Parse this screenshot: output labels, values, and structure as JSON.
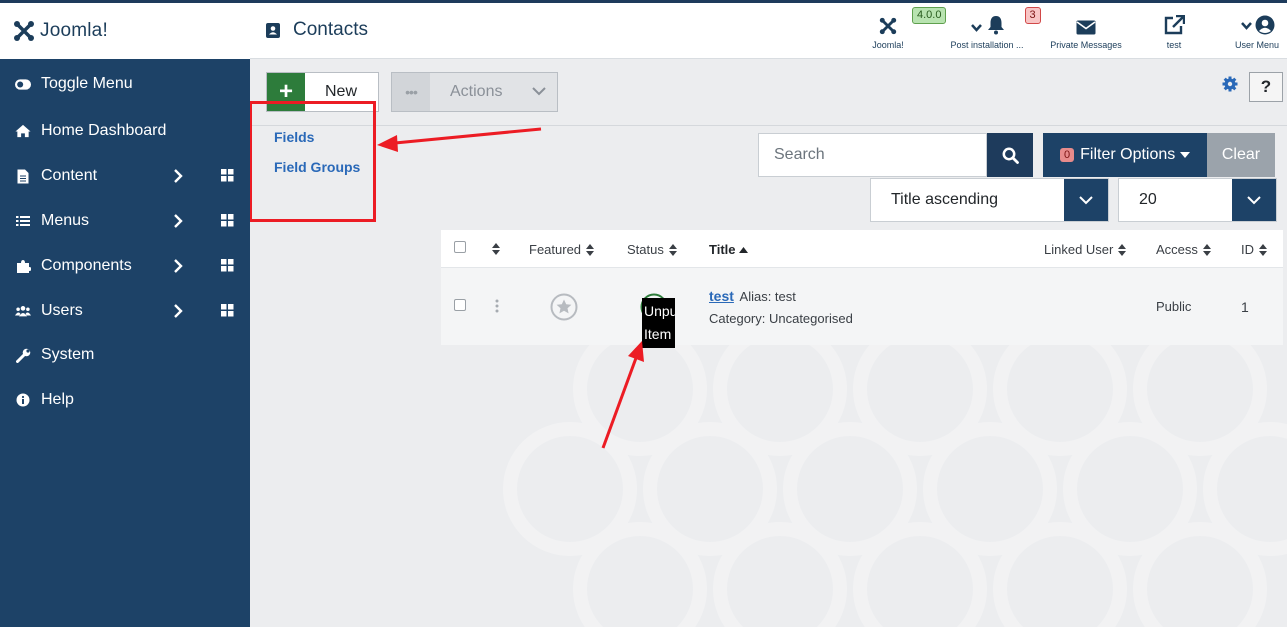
{
  "header": {
    "brand": "Joomla!",
    "page_title": "Contacts",
    "items": [
      {
        "label": "Joomla!",
        "badge": "4.0.0"
      },
      {
        "label": "Post installation ...",
        "badge": "3"
      },
      {
        "label": "Private Messages"
      },
      {
        "label": "test"
      },
      {
        "label": "User Menu"
      }
    ]
  },
  "sidebar": {
    "items": [
      {
        "label": "Toggle Menu",
        "icon": "toggle-icon"
      },
      {
        "label": "Home Dashboard",
        "icon": "home-icon"
      },
      {
        "label": "Content",
        "icon": "file-icon"
      },
      {
        "label": "Menus",
        "icon": "list-icon"
      },
      {
        "label": "Components",
        "icon": "puzzle-icon"
      },
      {
        "label": "Users",
        "icon": "users-icon"
      },
      {
        "label": "System",
        "icon": "wrench-icon"
      },
      {
        "label": "Help",
        "icon": "info-icon"
      }
    ]
  },
  "toolbar": {
    "new_label": "New",
    "actions_label": "Actions",
    "help_label": "?"
  },
  "submenu": {
    "fields": "Fields",
    "field_groups": "Field Groups"
  },
  "filters": {
    "search_placeholder": "Search",
    "filter_label": "Filter Options",
    "filter_count": "0",
    "clear_label": "Clear",
    "ordering": "Title ascending",
    "limit": "20"
  },
  "table": {
    "headers": {
      "featured": "Featured",
      "status": "Status",
      "title": "Title",
      "linked_user": "Linked User",
      "access": "Access",
      "id": "ID"
    },
    "rows": [
      {
        "title": "test",
        "alias": "Alias: test",
        "category": "Category: Uncategorised",
        "access": "Public",
        "id": "1",
        "tooltip_line1": "Unpublish",
        "tooltip_line2": "Item"
      }
    ]
  },
  "colors": {
    "sidebar": "#1d4267",
    "new_button": "#2d7c3b",
    "annotation": "#ec1c24"
  }
}
